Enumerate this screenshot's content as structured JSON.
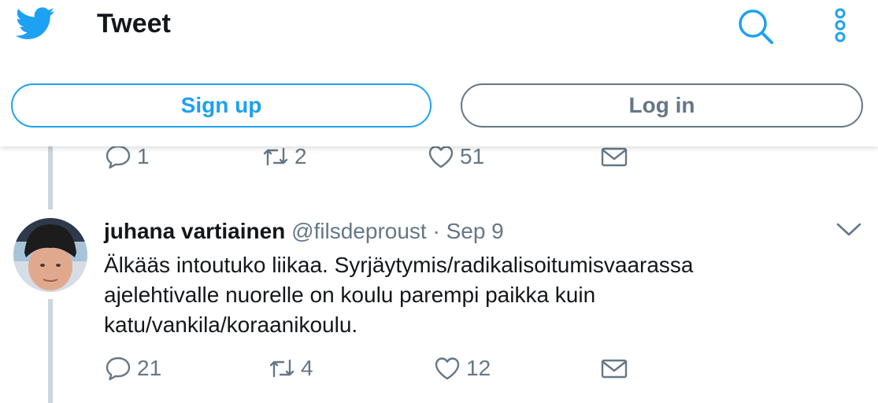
{
  "header": {
    "title": "Tweet",
    "icons": {
      "logo": "twitter-bird-icon",
      "search": "search-icon",
      "more": "more-vertical-icon"
    },
    "signup_label": "Sign up",
    "login_label": "Log in"
  },
  "colors": {
    "accent": "#1da1f2",
    "muted": "#657786",
    "text": "#14171a",
    "thread_line": "#ccd6dd"
  },
  "previous_tweet": {
    "replies": "1",
    "retweets": "2",
    "likes": "51"
  },
  "tweet": {
    "author_name": "juhana vartiainen",
    "handle": "@filsdeproust",
    "separator": "·",
    "date": "Sep 9",
    "text_lines": [
      "Älkääs intoutuko liikaa. Syrjäytymis/radikalisoitumisvaarassa",
      "ajelehtivalle nuorelle on koulu parempi paikka kuin",
      "katu/vankila/koraanikoulu."
    ],
    "replies": "21",
    "retweets": "4",
    "likes": "12"
  }
}
